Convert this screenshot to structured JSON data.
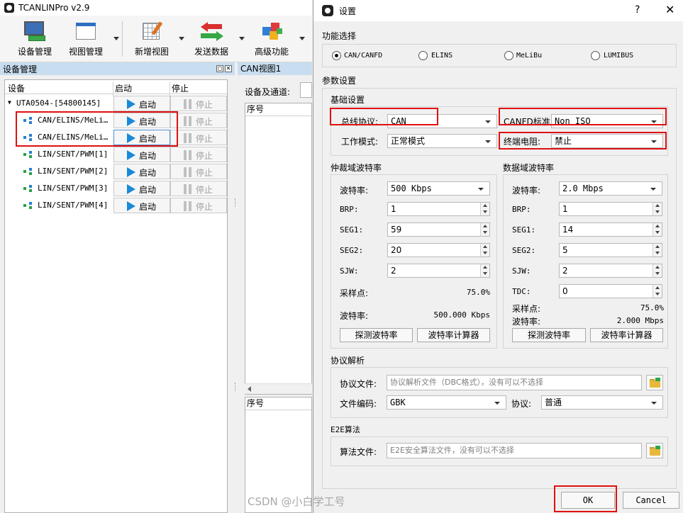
{
  "app": {
    "title": "TCANLINPro v2.9",
    "toolbar": [
      {
        "label": "设备管理",
        "icon": "device-manager-icon"
      },
      {
        "label": "视图管理",
        "icon": "view-manager-icon"
      },
      {
        "label": "新增视图",
        "icon": "new-view-icon"
      },
      {
        "label": "发送数据",
        "icon": "send-data-icon"
      },
      {
        "label": "高级功能",
        "icon": "advanced-function-icon"
      }
    ]
  },
  "device_panel": {
    "title": "设备管理",
    "columns": [
      "设备",
      "启动",
      "停止"
    ],
    "root_device": "UTA0504-[54800145]",
    "root_start": "启动",
    "root_stop": "停止",
    "channels": [
      {
        "name": "CAN/ELINS/MeLi…",
        "start": "启动",
        "stop": "停止"
      },
      {
        "name": "CAN/ELINS/MeLi…",
        "start": "启动",
        "stop": "停止"
      },
      {
        "name": "LIN/SENT/PWM[1]",
        "start": "启动",
        "stop": "停止"
      },
      {
        "name": "LIN/SENT/PWM[2]",
        "start": "启动",
        "stop": "停止"
      },
      {
        "name": "LIN/SENT/PWM[3]",
        "start": "启动",
        "stop": "停止"
      },
      {
        "name": "LIN/SENT/PWM[4]",
        "start": "启动",
        "stop": "停止"
      }
    ]
  },
  "can_view": {
    "tab": "CAN视图1",
    "device_channel_label": "设备及通道:",
    "table1_header": "序号",
    "table2_header": "序号"
  },
  "dialog": {
    "title": "设置",
    "help": "?",
    "close": "✕",
    "function_select": {
      "label": "功能选择",
      "options": [
        "CAN/CANFD",
        "ELINS",
        "MeLiBu",
        "LUMIBUS"
      ],
      "selected": "CAN/CANFD"
    },
    "param_label": "参数设置",
    "basic": {
      "label": "基础设置",
      "bus_protocol_label": "总线协议:",
      "bus_protocol": "CAN",
      "canfd_std_label": "CANFD标准:",
      "canfd_std": "Non ISO",
      "work_mode_label": "工作模式:",
      "work_mode": "正常模式",
      "termination_label": "终端电阻:",
      "termination": "禁止"
    },
    "arb": {
      "label": "仲裁域波特率",
      "baud_label": "波特率:",
      "baud": "500 Kbps",
      "brp_label": "BRP:",
      "brp": "1",
      "seg1_label": "SEG1:",
      "seg1": "59",
      "seg2_label": "SEG2:",
      "seg2": "20",
      "sjw_label": "SJW:",
      "sjw": "2",
      "sample_label": "采样点:",
      "sample": "75.0%",
      "baud2_label": "波特率:",
      "baud2": "500.000 Kbps",
      "detect_btn": "探测波特率",
      "calc_btn": "波特率计算器"
    },
    "data": {
      "label": "数据域波特率",
      "baud_label": "波特率:",
      "baud": "2.0 Mbps",
      "brp_label": "BRP:",
      "brp": "1",
      "seg1_label": "SEG1:",
      "seg1": "14",
      "seg2_label": "SEG2:",
      "seg2": "5",
      "sjw_label": "SJW:",
      "sjw": "2",
      "tdc_label": "TDC:",
      "tdc": "0",
      "sample_label": "采样点:",
      "sample": "75.0%",
      "baud2_label": "波特率:",
      "baud2": "2.000 Mbps",
      "detect_btn": "探测波特率",
      "calc_btn": "波特率计算器"
    },
    "protocol": {
      "label": "协议解析",
      "file_label": "协议文件:",
      "file_placeholder": "协议解析文件（DBC格式），没有可以不选择",
      "encoding_label": "文件编码:",
      "encoding": "GBK",
      "proto_label": "协议:",
      "proto": "普通"
    },
    "e2e": {
      "label": "E2E算法",
      "file_label": "算法文件:",
      "file_placeholder": "E2E安全算法文件，没有可以不选择"
    },
    "ok": "OK",
    "cancel": "Cancel"
  },
  "watermark": "CSDN @小白学工号",
  "colors": {
    "annotation": "#e01010",
    "accent": "#1a8ad8",
    "panel_header": "#c8ddef"
  }
}
